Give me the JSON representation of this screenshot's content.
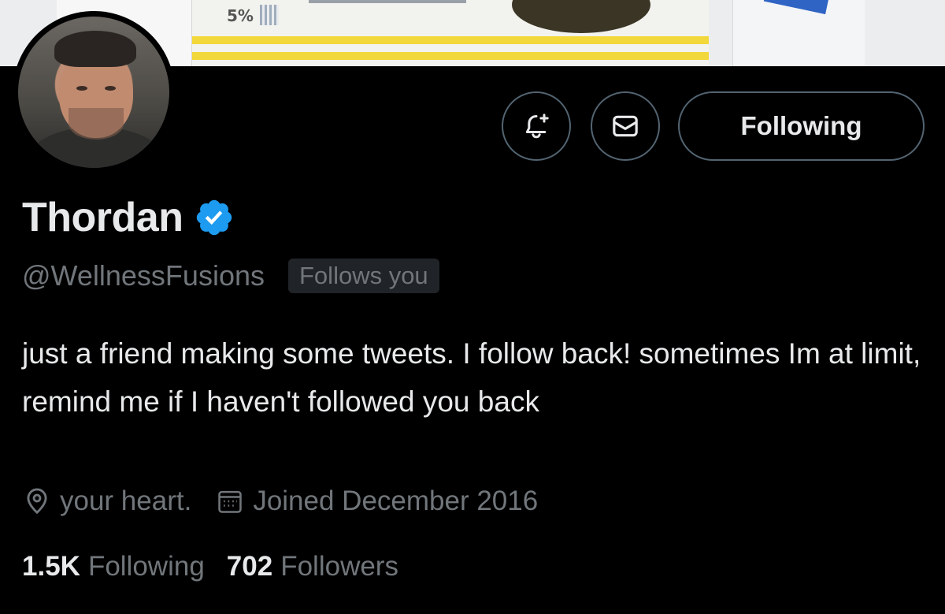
{
  "banner": {
    "badge_text": "5%"
  },
  "profile": {
    "name": "Thordan",
    "verified": true,
    "handle": "@WellnessFusions",
    "follows_you_label": "Follows you",
    "bio": "just a friend making some tweets. I follow back! sometimes Im at limit, remind me if I haven't followed you back",
    "location": "your heart.",
    "joined": "Joined December 2016"
  },
  "actions": {
    "following_label": "Following",
    "notify_icon": "bell-plus-icon",
    "message_icon": "envelope-icon"
  },
  "stats": {
    "following_count": "1.5K",
    "following_label": "Following",
    "followers_count": "702",
    "followers_label": "Followers"
  },
  "colors": {
    "background": "#000000",
    "text_primary": "#e7e9ea",
    "text_secondary": "#71767b",
    "border": "#536471",
    "verified_blue": "#1d9bf0",
    "badge_bg": "#202327"
  }
}
